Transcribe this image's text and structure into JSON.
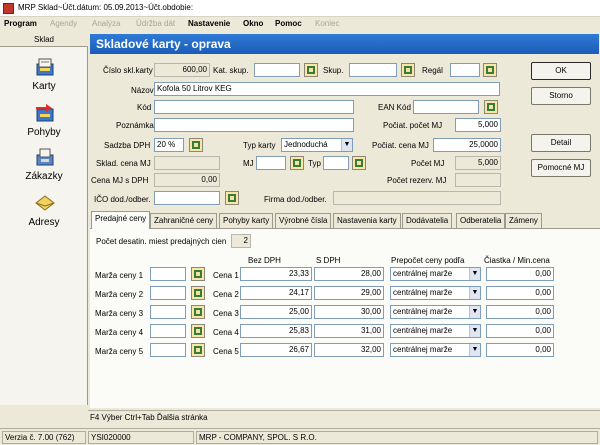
{
  "window": {
    "title": "MRP Sklad~Účt.dátum: 05.09.2013~Účt.obdobie:"
  },
  "menu": [
    {
      "label": "Program",
      "enabled": true
    },
    {
      "label": "Agendy",
      "enabled": false
    },
    {
      "label": "Analýza",
      "enabled": false
    },
    {
      "label": "Údržba dát",
      "enabled": false
    },
    {
      "label": "Nastavenie",
      "enabled": true
    },
    {
      "label": "Okno",
      "enabled": true
    },
    {
      "label": "Pomoc",
      "enabled": true
    },
    {
      "label": "Koniec",
      "enabled": false
    }
  ],
  "sidebar": {
    "title": "Sklad",
    "items": [
      {
        "label": "Karty",
        "icon": "cards-icon"
      },
      {
        "label": "Pohyby",
        "icon": "movements-icon"
      },
      {
        "label": "Zákazky",
        "icon": "orders-icon"
      },
      {
        "label": "Adresy",
        "icon": "addresses-icon"
      }
    ]
  },
  "header": {
    "title": "Skladové karty   -   oprava"
  },
  "form": {
    "cislo_label": "Číslo skl.karty",
    "cislo_value": "600,00",
    "katskup_label": "Kat. skup.",
    "katskup_value": "",
    "skup_label": "Skup.",
    "skup_value": "",
    "regal_label": "Regál",
    "regal_value": "",
    "nazov_label": "Názov",
    "nazov_value": "Kofola 50 Litrov KEG",
    "kod_label": "Kód",
    "kod_value": "",
    "ean_label": "EAN Kód",
    "ean_value": "",
    "poznamka_label": "Poznámka",
    "poznamka_value": "",
    "pocat_pocet_label": "Počiat. počet MJ",
    "pocat_pocet_value": "5,000",
    "sadzba_label": "Sadzba DPH",
    "sadzba_value": "20 %",
    "typkarty_label": "Typ karty",
    "typkarty_value": "Jednoduchá",
    "pocat_cena_label": "Počiat. cena MJ",
    "pocat_cena_value": "25,0000",
    "skladcena_label": "Sklad. cena MJ",
    "skladcena_value": "",
    "mj_label": "MJ",
    "mj_value": "",
    "typ_label": "Typ",
    "typ_value": "",
    "pocet_label": "Počet MJ",
    "pocet_value": "5,000",
    "cenadph_label": "Cena MJ s DPH",
    "cenadph_value": "0,00",
    "rezerv_label": "Počet rezerv. MJ",
    "rezerv_value": "",
    "ico_label": "IČO dod./odber.",
    "ico_value": "",
    "firma_label": "Firma dod./odber.",
    "firma_value": ""
  },
  "buttons": {
    "ok": "OK",
    "storno": "Storno",
    "detail": "Detail",
    "pomocne": "Pomocné MJ"
  },
  "tabs": [
    {
      "label": "Predajné ceny",
      "selected": true
    },
    {
      "label": "Zahraničné ceny",
      "selected": false
    },
    {
      "label": "Pohyby karty",
      "selected": false
    },
    {
      "label": "Výrobné čísla",
      "selected": false
    },
    {
      "label": "Nastavenia karty",
      "selected": false
    },
    {
      "label": "Dodávatelia",
      "selected": false
    },
    {
      "label": "Odberatelia",
      "selected": false
    },
    {
      "label": "Zámeny",
      "selected": false
    }
  ],
  "prices": {
    "decimals_label": "Počet desatin. miest predajných cien",
    "decimals_value": "2",
    "col_bez": "Bez DPH",
    "col_s": "S DPH",
    "col_prepocet": "Prepočet ceny podľa",
    "col_ciastka": "Čiastka / Min.cena",
    "rows": [
      {
        "marza_label": "Marža ceny 1",
        "marza": "",
        "cena_label": "Cena 1",
        "bez": "23,33",
        "s": "28,00",
        "prepocet": "centrálnej marže",
        "ciastka": "0,00"
      },
      {
        "marza_label": "Marža ceny 2",
        "marza": "",
        "cena_label": "Cena 2",
        "bez": "24,17",
        "s": "29,00",
        "prepocet": "centrálnej marže",
        "ciastka": "0,00"
      },
      {
        "marza_label": "Marža ceny 3",
        "marza": "",
        "cena_label": "Cena 3",
        "bez": "25,00",
        "s": "30,00",
        "prepocet": "centrálnej marže",
        "ciastka": "0,00"
      },
      {
        "marza_label": "Marža ceny 4",
        "marza": "",
        "cena_label": "Cena 4",
        "bez": "25,83",
        "s": "31,00",
        "prepocet": "centrálnej marže",
        "ciastka": "0,00"
      },
      {
        "marza_label": "Marža ceny 5",
        "marza": "",
        "cena_label": "Cena 5",
        "bez": "26,67",
        "s": "32,00",
        "prepocet": "centrálnej marže",
        "ciastka": "0,00"
      }
    ]
  },
  "hint": "F4 Výber  Ctrl+Tab Ďalšia stránka",
  "status": {
    "version": "Verzia č. 7.00 (762)",
    "ico": "YSI020000",
    "company": "MRP - COMPANY, SPOL. S R.O."
  }
}
